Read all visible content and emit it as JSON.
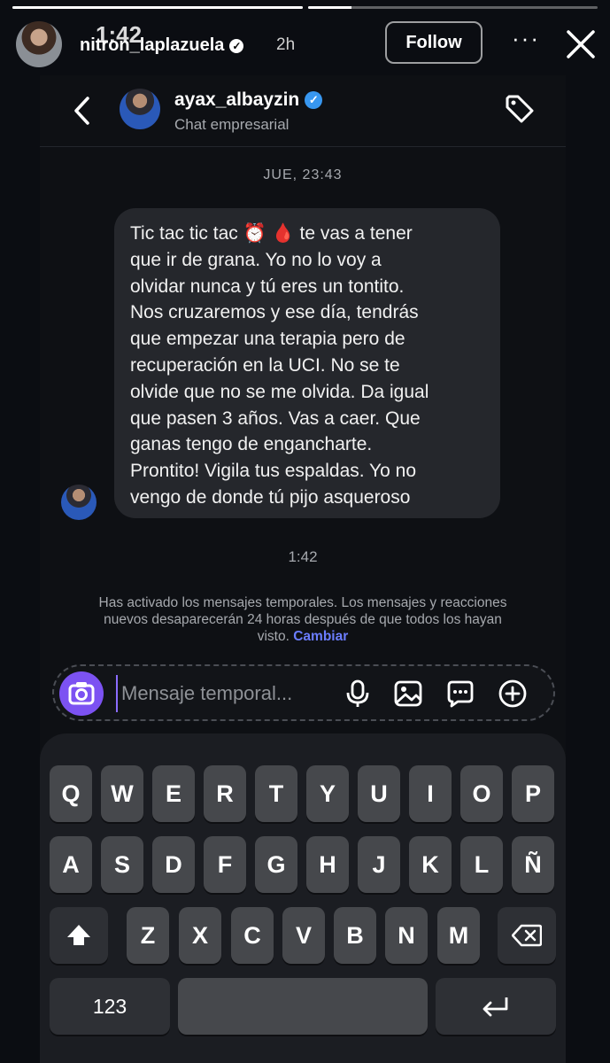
{
  "story": {
    "username": "nitron_laplazuela",
    "time_ago": "2h",
    "status_clock": "1:42",
    "follow_label": "Follow",
    "more_label": "···",
    "progress": [
      1.0,
      0.15
    ]
  },
  "chat": {
    "contact_name": "ayax_albayzin",
    "contact_subtitle": "Chat empresarial",
    "date_label": "JUE, 23:43",
    "message_lines": [
      "Tic tac tic tac ⏰ 🩸 te vas a tener",
      "que ir de grana. Yo no lo voy a",
      "olvidar nunca y tú eres un tontito.",
      "Nos cruzaremos y ese día, tendrás",
      "que empezar una terapia pero de",
      "recuperación en la UCI. No se te",
      "olvide que no se me olvida. Da igual",
      "que pasen 3 años. Vas a caer. Que",
      "ganas tengo de engancharte.",
      "Prontito!  Vigila tus espaldas. Yo no",
      "vengo de donde tú pijo asqueroso"
    ],
    "time_label": "1:42",
    "notice_text": "Has activado los mensajes temporales. Los mensajes y reacciones nuevos desaparecerán 24 horas después de que todos los hayan visto.",
    "notice_link": "Cambiar",
    "composer_placeholder": "Mensaje temporal..."
  },
  "keyboard": {
    "row1": [
      "Q",
      "W",
      "E",
      "R",
      "T",
      "Y",
      "U",
      "I",
      "O",
      "P"
    ],
    "row2": [
      "A",
      "S",
      "D",
      "F",
      "G",
      "H",
      "J",
      "K",
      "L",
      "Ñ"
    ],
    "row3": [
      "Z",
      "X",
      "C",
      "V",
      "B",
      "N",
      "M"
    ],
    "numbers_label": "123"
  },
  "icons": [
    "close-icon",
    "back-icon",
    "verified-icon",
    "tag-icon",
    "camera-icon",
    "microphone-icon",
    "image-icon",
    "sticker-icon",
    "plus-icon",
    "shift-icon",
    "backspace-icon",
    "return-icon"
  ],
  "colors": {
    "accent": "#7c52f2",
    "verified": "#3897f0",
    "link": "#6b7dff",
    "bubble": "#25272c"
  }
}
